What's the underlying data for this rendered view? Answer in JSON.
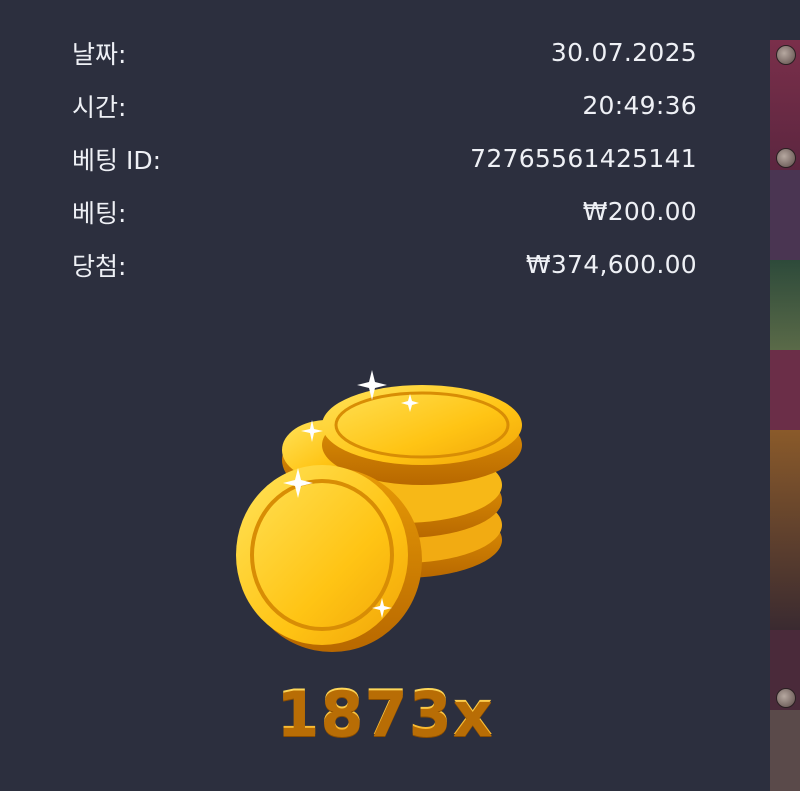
{
  "details": {
    "rows": [
      {
        "label": "날짜:",
        "value": "30.07.2025"
      },
      {
        "label": "시간:",
        "value": "20:49:36"
      },
      {
        "label": "베팅 ID:",
        "value": "72765561425141"
      },
      {
        "label": "베팅:",
        "value": "₩200.00"
      },
      {
        "label": "당첨:",
        "value": "₩374,600.00"
      }
    ]
  },
  "win": {
    "multiplier": "1873x",
    "icon": "gold-coins-icon"
  },
  "colors": {
    "background": "#2c2f3e",
    "text": "#eef0f5",
    "multiplier": "#f7b21c"
  }
}
